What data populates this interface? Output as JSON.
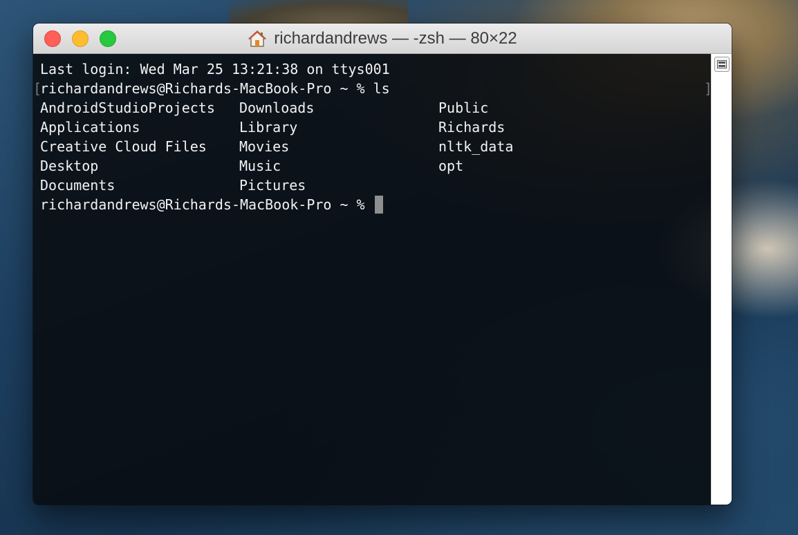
{
  "window": {
    "title": "richardandrews — -zsh — 80×22",
    "title_icon": "home-icon"
  },
  "terminal": {
    "last_login": "Last login: Wed Mar 25 13:21:38 on ttys001",
    "prompt_1": "richardandrews@Richards-MacBook-Pro ~ % ls",
    "ls_output": [
      [
        "AndroidStudioProjects",
        "Downloads",
        "Public"
      ],
      [
        "Applications",
        "Library",
        "Richards"
      ],
      [
        "Creative Cloud Files",
        "Movies",
        "nltk_data"
      ],
      [
        "Desktop",
        "Music",
        "opt"
      ],
      [
        "Documents",
        "Pictures",
        ""
      ]
    ],
    "prompt_2": "richardandrews@Richards-MacBook-Pro ~ % ",
    "mark_left": "[",
    "mark_right": "]"
  },
  "colors": {
    "close": "#fe5f57",
    "minimize": "#febc2e",
    "zoom": "#28c840",
    "terminal_text": "#f2f2f2"
  }
}
